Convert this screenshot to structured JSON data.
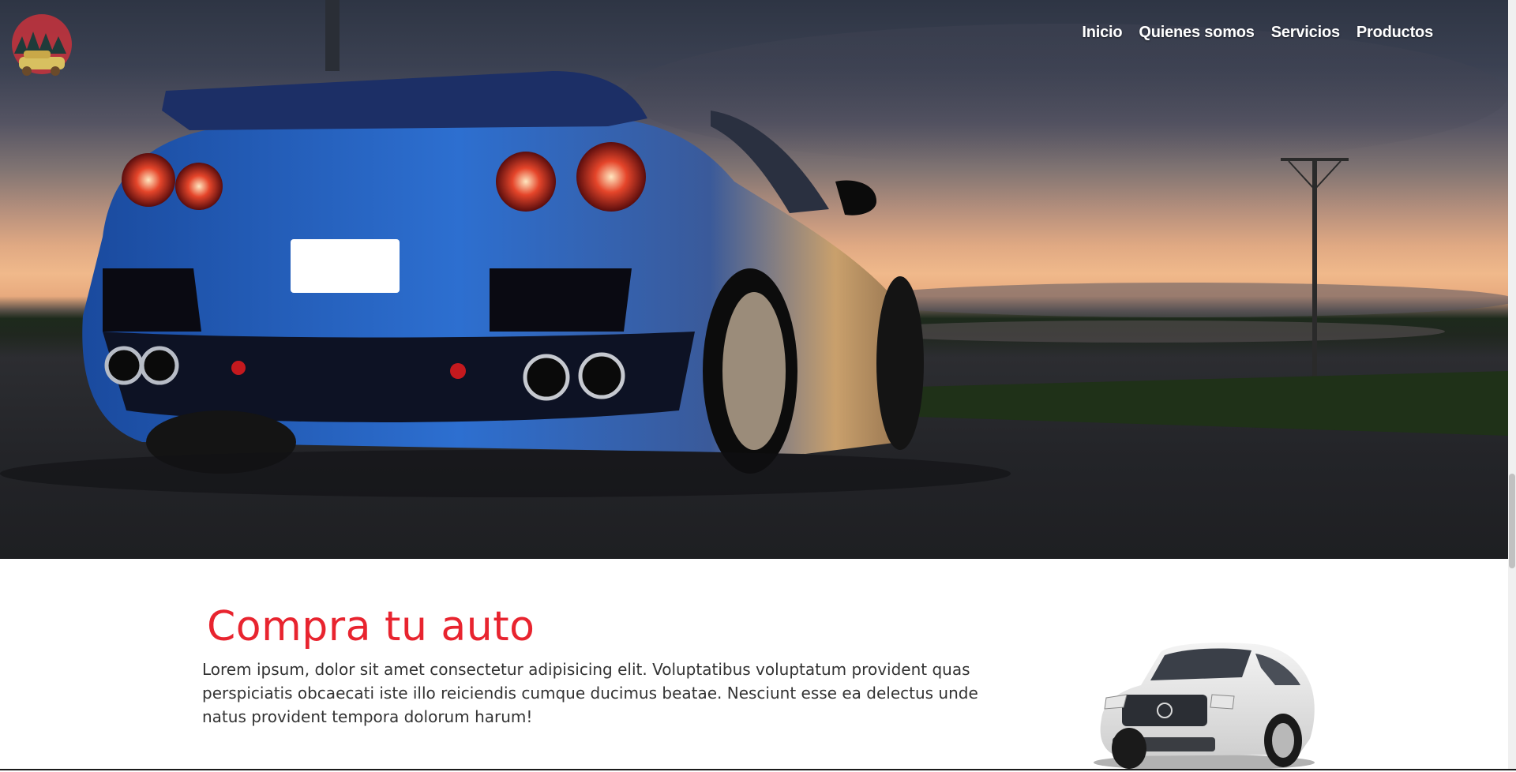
{
  "nav": {
    "items": [
      {
        "label": "Inicio"
      },
      {
        "label": "Quienes somos"
      },
      {
        "label": "Servicios"
      },
      {
        "label": "Productos"
      }
    ]
  },
  "hero": {
    "image": "blue-sports-car-at-sunset"
  },
  "content": {
    "title": "Compra tu auto",
    "description": "Lorem ipsum, dolor sit amet consectetur adipisicing elit. Voluptatibus voluptatum provident quas perspiciatis obcaecati iste illo reiciendis cumque ducimus beatae. Nesciunt esse ea delectus unde natus provident tempora dolorum harum!",
    "image": "white-suv"
  },
  "colors": {
    "accent": "#e8242f",
    "text": "#333333",
    "nav_text": "#ffffff"
  }
}
